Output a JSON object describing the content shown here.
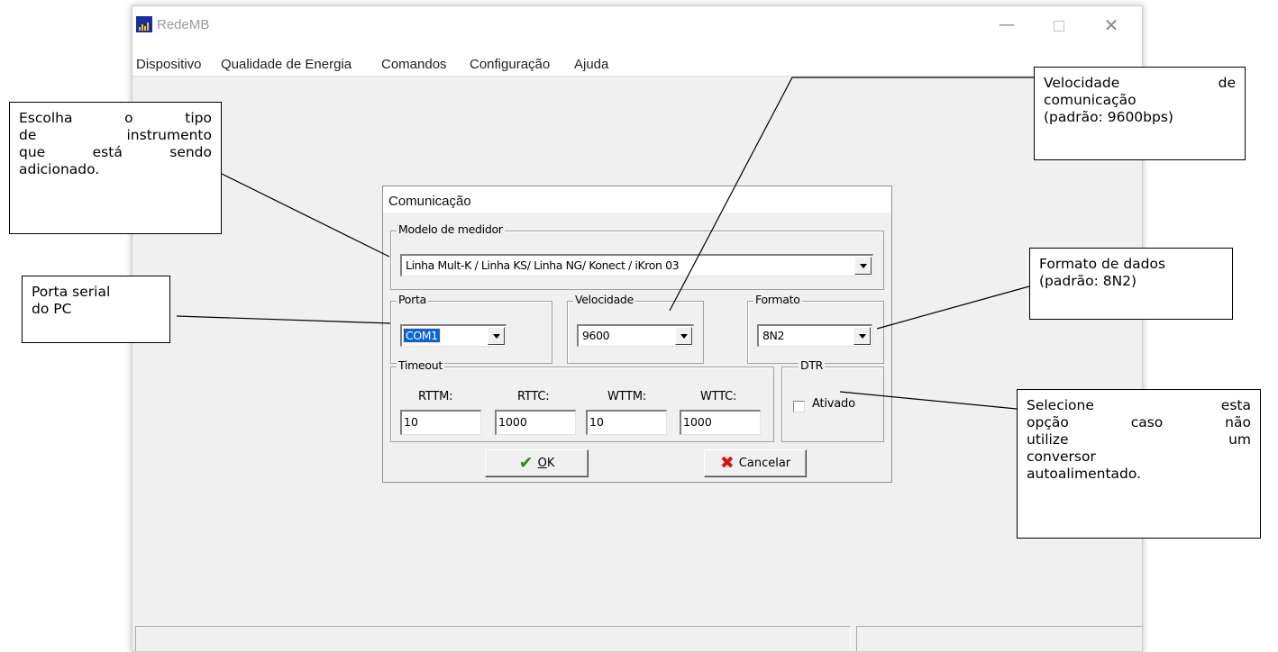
{
  "window": {
    "title": "RedeMB",
    "controls": {
      "minimize": "—",
      "close": "✕"
    }
  },
  "menu": [
    "Dispositivo",
    "Qualidade de Energia",
    "Comandos",
    "Configuração",
    "Ajuda"
  ],
  "dialog": {
    "title": "Comunicação",
    "model_group": {
      "label": "Modelo de medidor",
      "selected": "Linha Mult-K / Linha KS/ Linha NG/ Konect / iKron 03"
    },
    "port_group": {
      "label": "Porta",
      "selected": "COM1"
    },
    "speed_group": {
      "label": "Velocidade",
      "selected": "9600"
    },
    "format_group": {
      "label": "Formato",
      "selected": "8N2"
    },
    "timeout_group": {
      "label": "Timeout",
      "fields": [
        {
          "label": "RTTM:",
          "value": "10"
        },
        {
          "label": "RTTC:",
          "value": "1000"
        },
        {
          "label": "WTTM:",
          "value": "10"
        },
        {
          "label": "WTTC:",
          "value": "1000"
        }
      ]
    },
    "dtr_group": {
      "label": "DTR",
      "checkbox_label": "Ativado",
      "checked": false
    },
    "buttons": {
      "ok": "OK",
      "cancel": "Cancelar"
    }
  },
  "callouts": {
    "instrument": [
      "Escolha o tipo",
      "de instrumento",
      "que está sendo",
      "adicionado."
    ],
    "port": [
      "Porta serial",
      "do PC"
    ],
    "speed": [
      "Velocidade de",
      "comunicação",
      "(padrão: 9600bps)"
    ],
    "format": [
      "Formato de dados",
      "(padrão: 8N2)"
    ],
    "dtr": [
      "Selecione esta",
      "opção caso não",
      "utilize um",
      "conversor",
      "autoalimentado."
    ]
  },
  "colors": {
    "selection": "#0a64d8",
    "app_icon": "#1a2d9c",
    "ok_check": "#2e8a1f",
    "cancel_x": "#d11515"
  }
}
